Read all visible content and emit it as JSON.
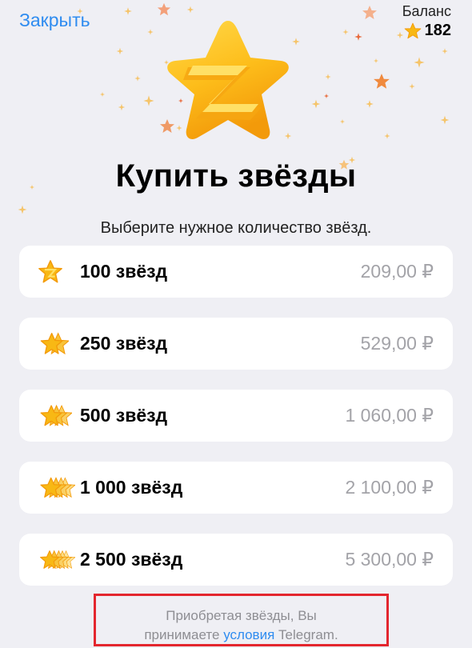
{
  "header": {
    "close_label": "Закрыть",
    "balance_label": "Баланс",
    "balance_value": "182",
    "balance_icon": "star-icon"
  },
  "title": "Купить звёзды",
  "subtitle": "Выберите нужное количество звёзд.",
  "options": [
    {
      "label": "100 звёзд",
      "price": "209,00 ₽",
      "icon": "star-icon"
    },
    {
      "label": "250 звёзд",
      "price": "529,00 ₽",
      "icon": "stars-icon"
    },
    {
      "label": "500 звёзд",
      "price": "1 060,00 ₽",
      "icon": "stars-icon"
    },
    {
      "label": "1 000 звёзд",
      "price": "2 100,00 ₽",
      "icon": "stars-icon"
    },
    {
      "label": "2 500 звёзд",
      "price": "5 300,00 ₽",
      "icon": "stars-icon"
    }
  ],
  "terms": {
    "line1": "Приобретая звёзды, Вы",
    "line2_prefix": "принимаете ",
    "link": "условия",
    "line2_suffix": " Telegram."
  },
  "colors": {
    "accent": "#2f8cf0",
    "star": "#f8b814",
    "highlight_border": "#e3262e",
    "background": "#efeff4"
  }
}
